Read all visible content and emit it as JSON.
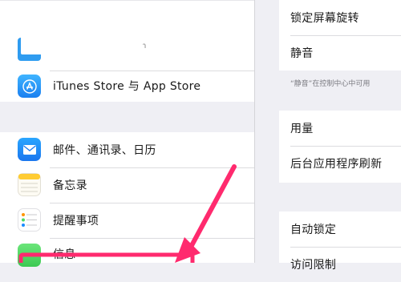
{
  "left": {
    "account_blurb": "n",
    "itunes_row": {
      "label": "iTunes Store 与 App Store",
      "icon": "app-store-icon"
    },
    "apps": [
      {
        "label": "邮件、通讯录、日历",
        "icon": "mail-icon"
      },
      {
        "label": "备忘录",
        "icon": "notes-icon"
      },
      {
        "label": "提醒事项",
        "icon": "reminders-icon"
      },
      {
        "label": "信息",
        "icon": "messages-icon"
      }
    ]
  },
  "right": {
    "rows_top": [
      "锁定屏幕旋转",
      "静音"
    ],
    "footnote": "“静音”在控制中心中可用",
    "rows_mid": [
      "用量",
      "后台应用程序刷新"
    ],
    "rows_bottom": [
      "自动锁定",
      "访问限制"
    ]
  },
  "colors": {
    "accent_arrow": "#ff2a6e",
    "mail": "#1e88ff",
    "app_store": "#1a8cff",
    "messages": "#4cd964",
    "notes": "#ffcc33"
  }
}
